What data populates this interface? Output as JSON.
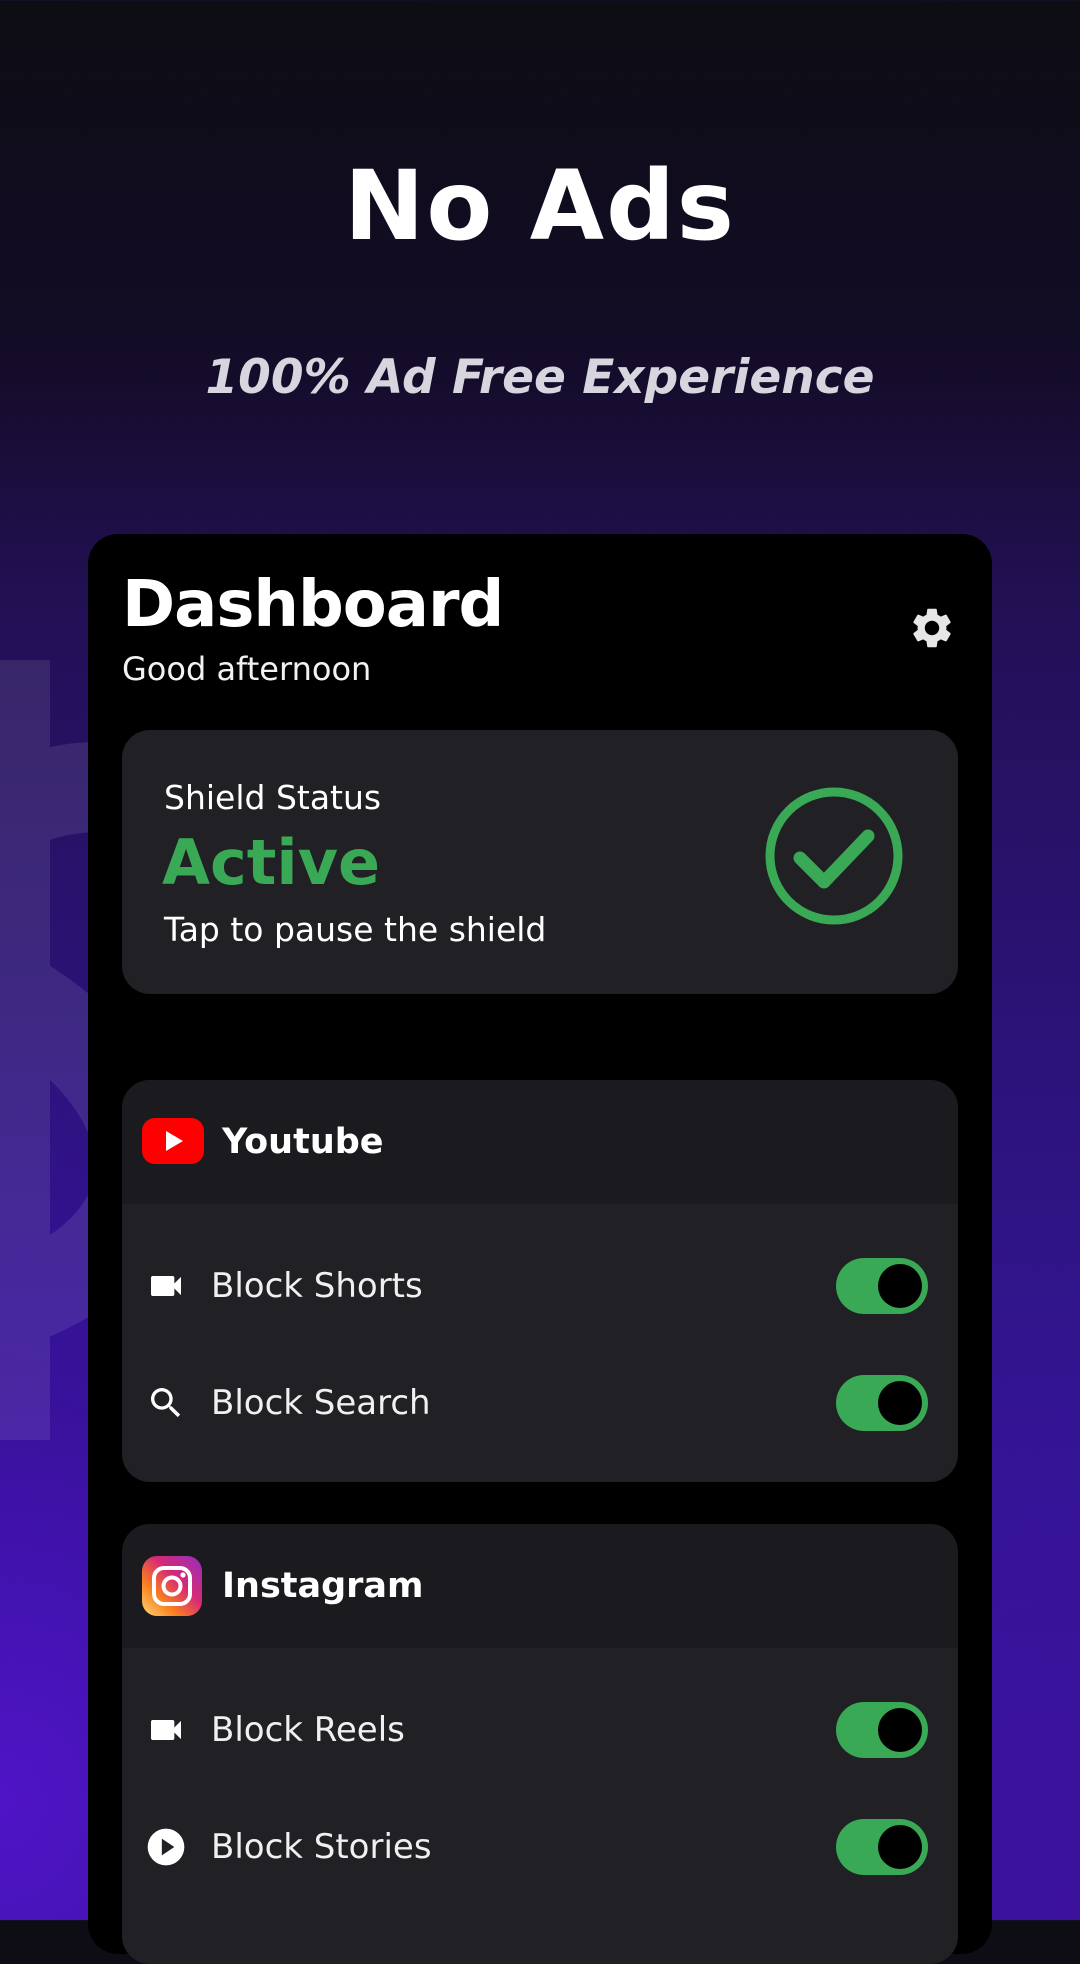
{
  "hero": {
    "title": "No Ads",
    "subtitle": "100% Ad Free Experience"
  },
  "dashboard": {
    "title": "Dashboard",
    "greeting": "Good afternoon",
    "settings_icon": "gear-icon"
  },
  "shield": {
    "label": "Shield Status",
    "status": "Active",
    "hint": "Tap to pause the shield",
    "status_color": "#3aa955",
    "icon": "check-circle-icon"
  },
  "apps": [
    {
      "name": "Youtube",
      "icon": "youtube-logo-icon",
      "items": [
        {
          "label": "Block Shorts",
          "icon": "video-camera-icon",
          "enabled": true
        },
        {
          "label": "Block Search",
          "icon": "search-icon",
          "enabled": true
        }
      ]
    },
    {
      "name": "Instagram",
      "icon": "instagram-logo-icon",
      "items": [
        {
          "label": "Block Reels",
          "icon": "video-camera-icon",
          "enabled": true
        },
        {
          "label": "Block Stories",
          "icon": "play-circle-icon",
          "enabled": true
        }
      ]
    }
  ],
  "colors": {
    "accent_green": "#3aa955",
    "card_bg": "#212025",
    "youtube_red": "#ff0000"
  }
}
